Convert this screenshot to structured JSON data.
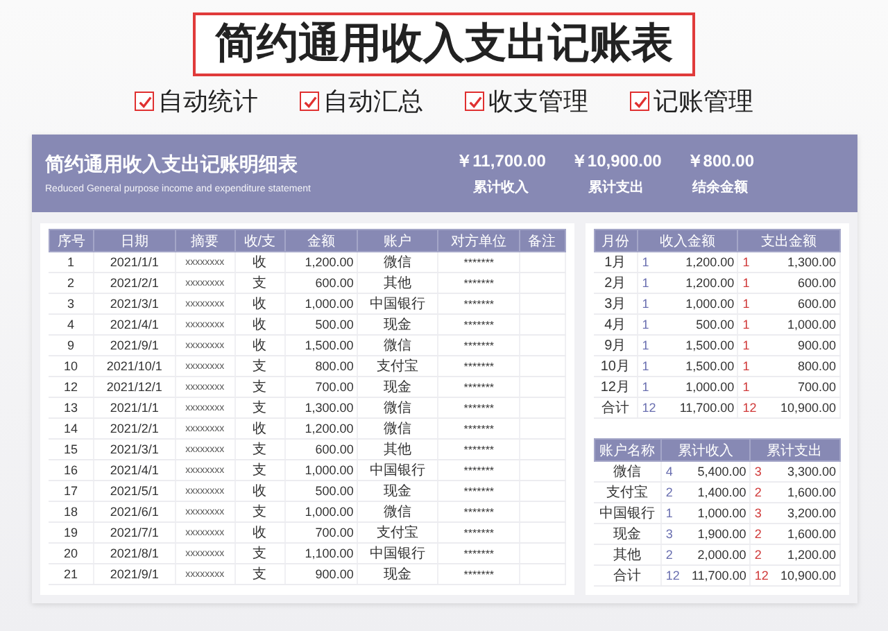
{
  "heading": {
    "title": "简约通用收入支出记账表"
  },
  "features": [
    {
      "label": "自动统计",
      "checked": true
    },
    {
      "label": "自动汇总",
      "checked": true
    },
    {
      "label": "收支管理",
      "checked": true
    },
    {
      "label": "记账管理",
      "checked": true
    }
  ],
  "banner": {
    "title": "简约通用收入支出记账明细表",
    "subtitle": "Reduced General purpose income and expenditure statement",
    "stats": [
      {
        "value": "￥11,700.00",
        "label": "累计收入"
      },
      {
        "value": "￥10,900.00",
        "label": "累计支出"
      },
      {
        "value": "￥800.00",
        "label": "结余金额"
      }
    ]
  },
  "ledger": {
    "columns": [
      "序号",
      "日期",
      "摘要",
      "收/支",
      "金额",
      "账户",
      "对方单位",
      "备注"
    ],
    "rows": [
      {
        "no": "1",
        "date": "2021/1/1",
        "summary": "xxxxxxxx",
        "type": "收",
        "amount": "1,200.00",
        "account": "微信",
        "counterparty": "*******"
      },
      {
        "no": "2",
        "date": "2021/2/1",
        "summary": "xxxxxxxx",
        "type": "支",
        "amount": "600.00",
        "account": "其他",
        "counterparty": "*******"
      },
      {
        "no": "3",
        "date": "2021/3/1",
        "summary": "xxxxxxxx",
        "type": "收",
        "amount": "1,000.00",
        "account": "中国银行",
        "counterparty": "*******"
      },
      {
        "no": "4",
        "date": "2021/4/1",
        "summary": "xxxxxxxx",
        "type": "收",
        "amount": "500.00",
        "account": "现金",
        "counterparty": "*******"
      },
      {
        "no": "9",
        "date": "2021/9/1",
        "summary": "xxxxxxxx",
        "type": "收",
        "amount": "1,500.00",
        "account": "微信",
        "counterparty": "*******"
      },
      {
        "no": "10",
        "date": "2021/10/1",
        "summary": "xxxxxxxx",
        "type": "支",
        "amount": "800.00",
        "account": "支付宝",
        "counterparty": "*******"
      },
      {
        "no": "12",
        "date": "2021/12/1",
        "summary": "xxxxxxxx",
        "type": "支",
        "amount": "700.00",
        "account": "现金",
        "counterparty": "*******"
      },
      {
        "no": "13",
        "date": "2021/1/1",
        "summary": "xxxxxxxx",
        "type": "支",
        "amount": "1,300.00",
        "account": "微信",
        "counterparty": "*******"
      },
      {
        "no": "14",
        "date": "2021/2/1",
        "summary": "xxxxxxxx",
        "type": "收",
        "amount": "1,200.00",
        "account": "微信",
        "counterparty": "*******"
      },
      {
        "no": "15",
        "date": "2021/3/1",
        "summary": "xxxxxxxx",
        "type": "支",
        "amount": "600.00",
        "account": "其他",
        "counterparty": "*******"
      },
      {
        "no": "16",
        "date": "2021/4/1",
        "summary": "xxxxxxxx",
        "type": "支",
        "amount": "1,000.00",
        "account": "中国银行",
        "counterparty": "*******"
      },
      {
        "no": "17",
        "date": "2021/5/1",
        "summary": "xxxxxxxx",
        "type": "收",
        "amount": "500.00",
        "account": "现金",
        "counterparty": "*******"
      },
      {
        "no": "18",
        "date": "2021/6/1",
        "summary": "xxxxxxxx",
        "type": "支",
        "amount": "1,000.00",
        "account": "微信",
        "counterparty": "*******"
      },
      {
        "no": "19",
        "date": "2021/7/1",
        "summary": "xxxxxxxx",
        "type": "收",
        "amount": "700.00",
        "account": "支付宝",
        "counterparty": "*******"
      },
      {
        "no": "20",
        "date": "2021/8/1",
        "summary": "xxxxxxxx",
        "type": "支",
        "amount": "1,100.00",
        "account": "中国银行",
        "counterparty": "*******"
      },
      {
        "no": "21",
        "date": "2021/9/1",
        "summary": "xxxxxxxx",
        "type": "支",
        "amount": "900.00",
        "account": "现金",
        "counterparty": "*******"
      }
    ]
  },
  "monthly": {
    "columns": [
      "月份",
      "收入金额",
      "支出金额"
    ],
    "rows": [
      {
        "name": "1月",
        "income_count": "1",
        "income": "1,200.00",
        "expense_count": "1",
        "expense": "1,300.00"
      },
      {
        "name": "2月",
        "income_count": "1",
        "income": "1,200.00",
        "expense_count": "1",
        "expense": "600.00"
      },
      {
        "name": "3月",
        "income_count": "1",
        "income": "1,000.00",
        "expense_count": "1",
        "expense": "600.00"
      },
      {
        "name": "4月",
        "income_count": "1",
        "income": "500.00",
        "expense_count": "1",
        "expense": "1,000.00"
      },
      {
        "name": "9月",
        "income_count": "1",
        "income": "1,500.00",
        "expense_count": "1",
        "expense": "900.00"
      },
      {
        "name": "10月",
        "income_count": "1",
        "income": "1,500.00",
        "expense_count": "1",
        "expense": "800.00"
      },
      {
        "name": "12月",
        "income_count": "1",
        "income": "1,000.00",
        "expense_count": "1",
        "expense": "700.00"
      },
      {
        "name": "合计",
        "income_count": "12",
        "income": "11,700.00",
        "expense_count": "12",
        "expense": "10,900.00"
      }
    ]
  },
  "accounts": {
    "columns": [
      "账户名称",
      "累计收入",
      "累计支出"
    ],
    "rows": [
      {
        "name": "微信",
        "income_count": "4",
        "income": "5,400.00",
        "expense_count": "3",
        "expense": "3,300.00"
      },
      {
        "name": "支付宝",
        "income_count": "2",
        "income": "1,400.00",
        "expense_count": "2",
        "expense": "1,600.00"
      },
      {
        "name": "中国银行",
        "income_count": "1",
        "income": "1,000.00",
        "expense_count": "3",
        "expense": "3,200.00"
      },
      {
        "name": "现金",
        "income_count": "3",
        "income": "1,900.00",
        "expense_count": "2",
        "expense": "1,600.00"
      },
      {
        "name": "其他",
        "income_count": "2",
        "income": "2,000.00",
        "expense_count": "2",
        "expense": "1,200.00"
      },
      {
        "name": "合计",
        "income_count": "12",
        "income": "11,700.00",
        "expense_count": "12",
        "expense": "10,900.00"
      }
    ]
  }
}
